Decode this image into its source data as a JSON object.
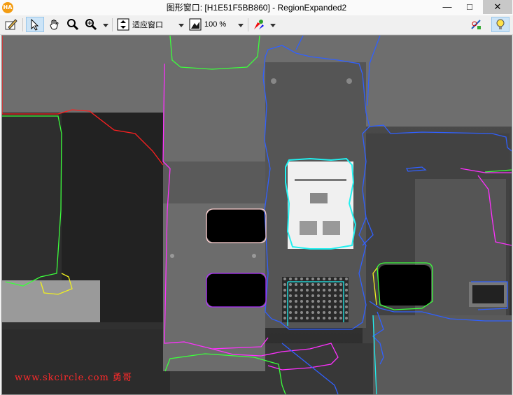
{
  "window": {
    "title": "图形窗口: [H1E51F5BB860] - RegionExpanded2",
    "app_icon_text": "HA",
    "minimize_glyph": "—",
    "maximize_glyph": "□",
    "close_glyph": "✕"
  },
  "toolbar": {
    "zoom_mode": "适应窗口",
    "zoom_percent": "100 %",
    "icons": [
      "edit-icon",
      "pointer-icon",
      "pan-hand-icon",
      "magnifier-icon",
      "zoom-in-icon",
      "zoom-mode-icon",
      "percent-zoom-icon",
      "color-picker-icon",
      "inspect-icon",
      "lightbulb-icon"
    ]
  },
  "canvas": {
    "watermark": "www.skcircle.com 勇哥"
  },
  "colors": {
    "region_red": "#ff2020",
    "region_green": "#3cff3c",
    "region_blue": "#2020ff",
    "region_cyan": "#20f0f0",
    "region_magenta": "#ff30ff",
    "region_yellow": "#f0f020",
    "region_purple": "#b030ff"
  }
}
